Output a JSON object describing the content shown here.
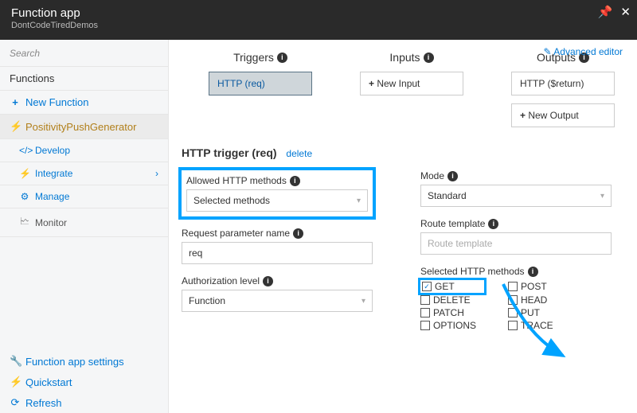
{
  "header": {
    "title": "Function app",
    "subtitle": "DontCodeTiredDemos"
  },
  "sidebar": {
    "search_placeholder": "Search",
    "functions_label": "Functions",
    "new_function": "New Function",
    "function_name": "PositivityPushGenerator",
    "develop": "Develop",
    "integrate": "Integrate",
    "manage": "Manage",
    "monitor": "Monitor",
    "app_settings": "Function app settings",
    "quickstart": "Quickstart",
    "refresh": "Refresh"
  },
  "main": {
    "advanced": "Advanced editor",
    "triggers": {
      "head": "Triggers",
      "item": "HTTP (req)"
    },
    "inputs": {
      "head": "Inputs",
      "item": "New Input"
    },
    "outputs": {
      "head": "Outputs",
      "item1": "HTTP ($return)",
      "item2": "New Output"
    },
    "section_title": "HTTP trigger (req)",
    "delete": "delete",
    "allowed_label": "Allowed HTTP methods",
    "allowed_value": "Selected methods",
    "param_label": "Request parameter name",
    "param_value": "req",
    "auth_label": "Authorization level",
    "auth_value": "Function",
    "mode_label": "Mode",
    "mode_value": "Standard",
    "route_label": "Route template",
    "route_placeholder": "Route template",
    "sel_methods_label": "Selected HTTP methods",
    "methods": {
      "get": "GET",
      "post": "POST",
      "delete": "DELETE",
      "head": "HEAD",
      "patch": "PATCH",
      "put": "PUT",
      "options": "OPTIONS",
      "trace": "TRACE"
    }
  }
}
